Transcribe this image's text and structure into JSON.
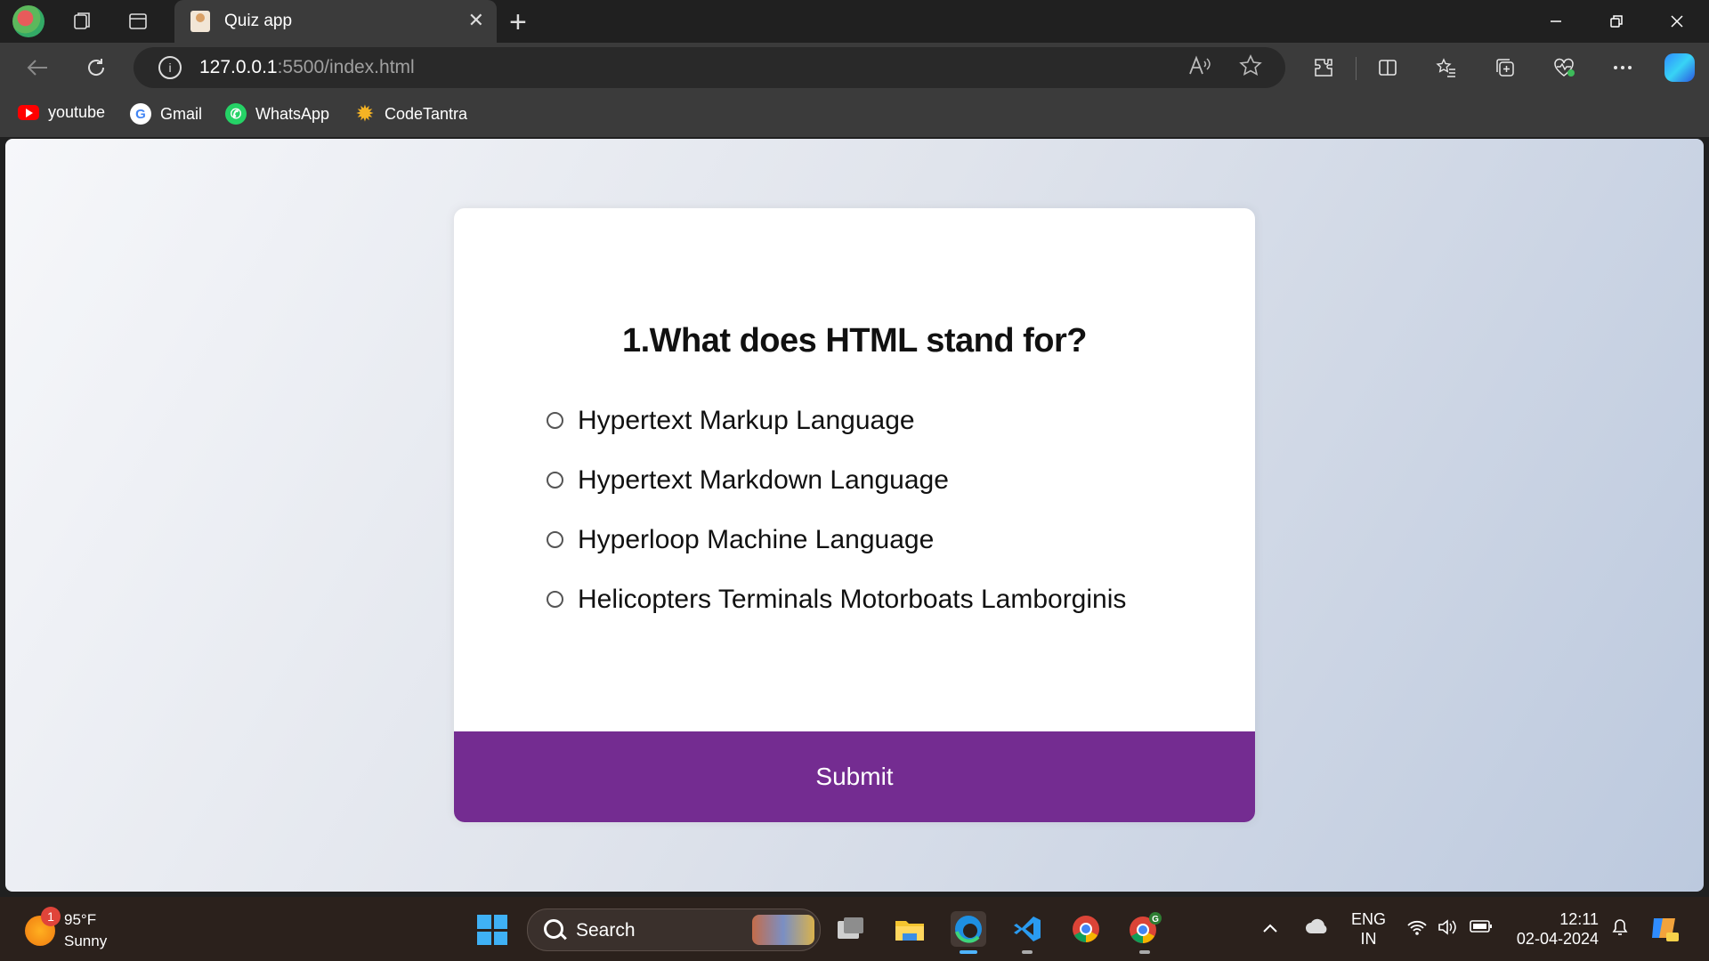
{
  "browser": {
    "tab_title": "Quiz app",
    "close_glyph": "✕",
    "new_tab_glyph": "+",
    "url_host": "127.0.0.1",
    "url_path": ":5500/index.html",
    "window_controls": [
      "minimize",
      "restore",
      "close"
    ]
  },
  "bookmarks": [
    {
      "label": "youtube",
      "icon": "youtube-icon"
    },
    {
      "label": "Gmail",
      "icon": "google-icon"
    },
    {
      "label": "WhatsApp",
      "icon": "whatsapp-icon"
    },
    {
      "label": "CodeTantra",
      "icon": "codetantra-icon"
    }
  ],
  "quiz": {
    "question": "1.What does HTML stand for?",
    "answers": [
      "Hypertext Markup Language",
      "Hypertext Markdown Language",
      "Hyperloop Machine Language",
      "Helicopters Terminals Motorboats Lamborginis"
    ],
    "submit_label": "Submit",
    "accent_color": "#742c91"
  },
  "taskbar": {
    "weather_temp": "95°F",
    "weather_desc": "Sunny",
    "weather_badge": "1",
    "search_label": "Search",
    "lang_top": "ENG",
    "lang_bottom": "IN",
    "time": "12:11",
    "date": "02-04-2024"
  }
}
